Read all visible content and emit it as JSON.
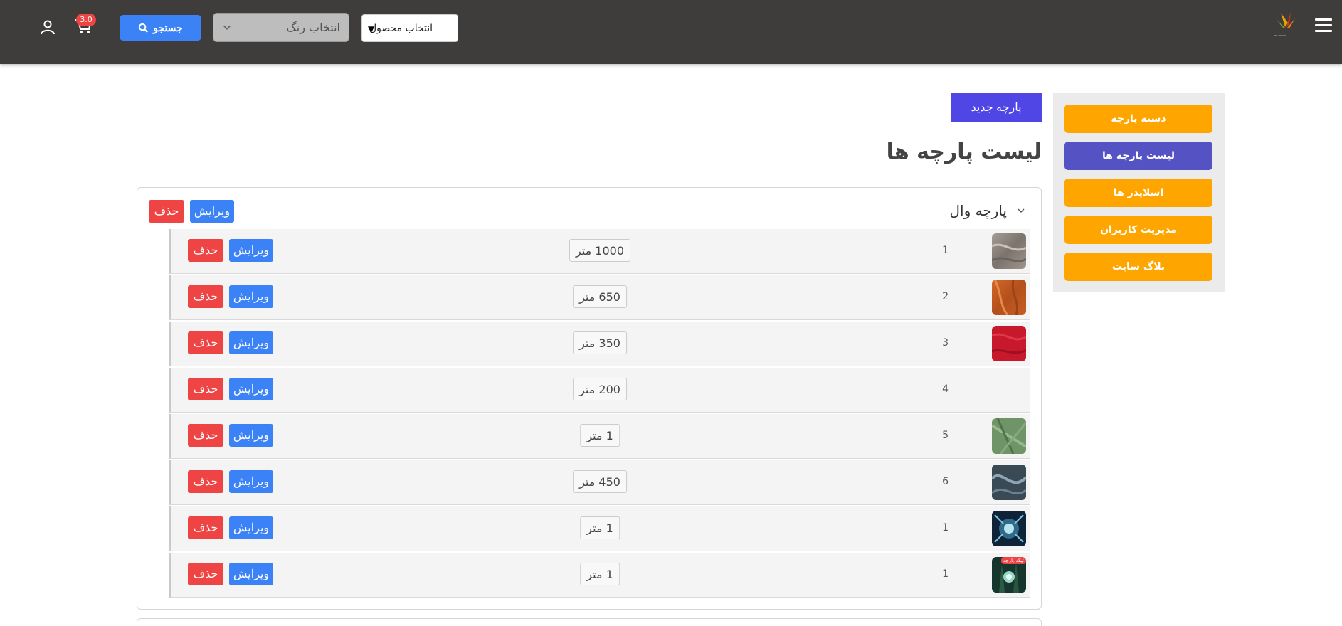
{
  "header": {
    "select_product": "انتخاب محصول",
    "select_color_placeholder": "انتخاب رنگ",
    "search_label": "جستجو",
    "cart_badge": "3.0"
  },
  "sidebar": {
    "items": [
      {
        "label": "دسته پارچه",
        "active": false
      },
      {
        "label": "لیست پارچه ها",
        "active": true
      },
      {
        "label": "اسلایدر ها",
        "active": false
      },
      {
        "label": "مدیریت کاربران",
        "active": false
      },
      {
        "label": "بلاگ سایت",
        "active": false
      }
    ]
  },
  "main": {
    "new_button": "پارچه جدید",
    "title": "لیست پارچه ها",
    "group": {
      "title": "پارچه وال",
      "edit_label": "ویرایش",
      "delete_label": "حذف"
    },
    "rows": [
      {
        "index": "1",
        "qty": "1000 متر",
        "edit": "ویرایش",
        "delete": "حذف",
        "swatch": "gray"
      },
      {
        "index": "2",
        "qty": "650 متر",
        "edit": "ویرایش",
        "delete": "حذف",
        "swatch": "orange"
      },
      {
        "index": "3",
        "qty": "350 متر",
        "edit": "ویرایش",
        "delete": "حذف",
        "swatch": "red"
      },
      {
        "index": "4",
        "qty": "200 متر",
        "edit": "ویرایش",
        "delete": "حذف",
        "swatch": "none"
      },
      {
        "index": "5",
        "qty": "1 متر",
        "edit": "ویرایش",
        "delete": "حذف",
        "swatch": "green"
      },
      {
        "index": "6",
        "qty": "450 متر",
        "edit": "ویرایش",
        "delete": "حذف",
        "swatch": "steel"
      },
      {
        "index": "1",
        "qty": "1 متر",
        "edit": "ویرایش",
        "delete": "حذف",
        "swatch": "galaxy"
      },
      {
        "index": "1",
        "qty": "1 متر",
        "edit": "ویرایش",
        "delete": "حذف",
        "swatch": "forest",
        "badge": "تیکه پارچه"
      }
    ]
  },
  "colors": {
    "header_bg": "#3f3d3b",
    "accent_blue": "#3b82f6",
    "danger": "#ef4444",
    "sidebar_orange": "#ffa500",
    "sidebar_active": "#5552c4",
    "new_button": "#4f46e5"
  }
}
